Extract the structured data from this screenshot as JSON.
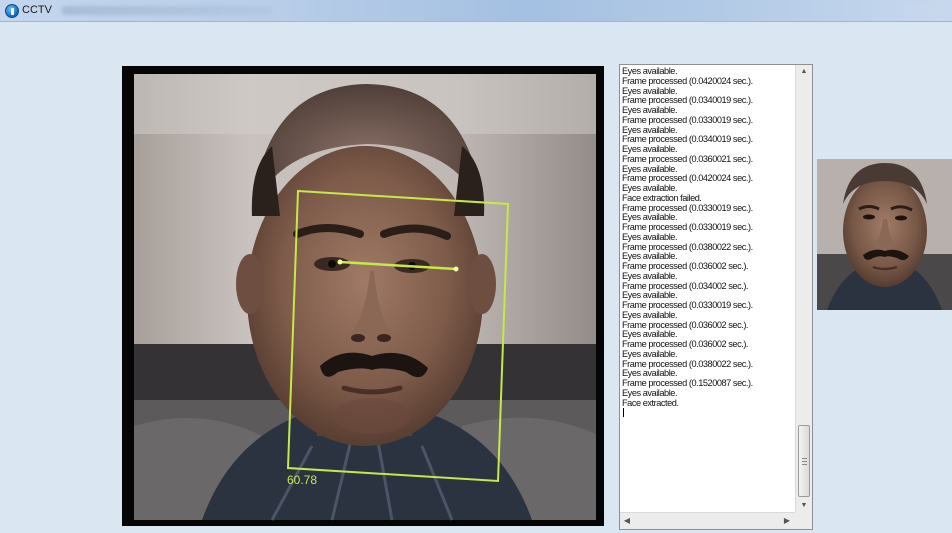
{
  "window": {
    "title": "CCTV",
    "app_icon": "app-icon"
  },
  "camera": {
    "face_score": "60.78",
    "detection_box_color": "#c6e84a",
    "eye_line_color": "#c6e84a"
  },
  "log": {
    "lines": [
      "Eyes available.",
      "Frame processed (0.0420024 sec.).",
      "Eyes available.",
      "Frame processed (0.0340019 sec.).",
      "Eyes available.",
      "Frame processed (0.0330019 sec.).",
      "Eyes available.",
      "Frame processed (0.0340019 sec.).",
      "Eyes available.",
      "Frame processed (0.0360021 sec.).",
      "Eyes available.",
      "Frame processed (0.0420024 sec.).",
      "Eyes available.",
      "Face extraction failed.",
      "Frame processed (0.0330019 sec.).",
      "Eyes available.",
      "Frame processed (0.0330019 sec.).",
      "Eyes available.",
      "Frame processed (0.0380022 sec.).",
      "Eyes available.",
      "Frame processed (0.036002 sec.).",
      "Eyes available.",
      "Frame processed (0.034002 sec.).",
      "Eyes available.",
      "Frame processed (0.0330019 sec.).",
      "Eyes available.",
      "Frame processed (0.036002 sec.).",
      "Eyes available.",
      "Frame processed (0.036002 sec.).",
      "Eyes available.",
      "Frame processed (0.0380022 sec.).",
      "Eyes available.",
      "Frame processed (0.1520087 sec.).",
      "Eyes available.",
      "Face extracted."
    ]
  },
  "thumbnail": {
    "label": "extracted-face-thumbnail"
  }
}
